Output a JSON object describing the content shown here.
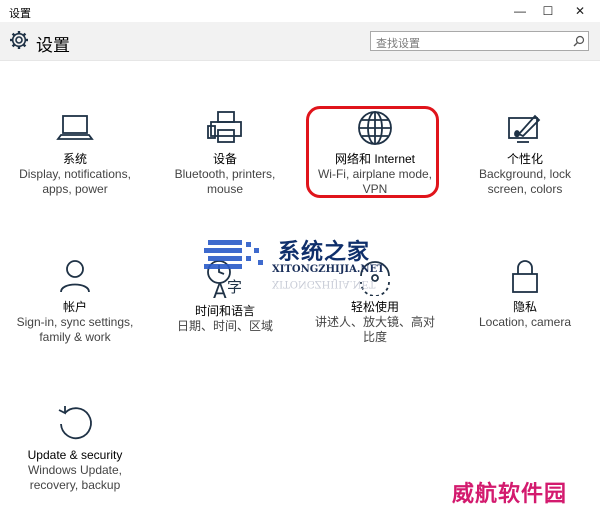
{
  "window": {
    "title": "设置",
    "minimize": "—",
    "maximize": "☐",
    "close": "✕"
  },
  "header": {
    "title": "设置",
    "search_placeholder": "查找设置"
  },
  "tiles": [
    {
      "label": "系统",
      "desc": [
        "Display, notifications,",
        "apps, power"
      ],
      "icon": "laptop-icon"
    },
    {
      "label": "设备",
      "desc": [
        "Bluetooth, printers,",
        "mouse"
      ],
      "icon": "printer-icon"
    },
    {
      "label": "网络和 Internet",
      "desc": [
        "Wi-Fi, airplane mode,",
        "VPN"
      ],
      "icon": "globe-icon"
    },
    {
      "label": "个性化",
      "desc": [
        "Background, lock",
        "screen, colors"
      ],
      "icon": "paintbrush-icon"
    },
    {
      "label": "帐户",
      "desc": [
        "Sign-in, sync settings,",
        "family & work"
      ],
      "icon": "person-icon"
    },
    {
      "label": "时间和语言",
      "desc": [
        "日期、时间、区域"
      ],
      "icon": "time-language-icon"
    },
    {
      "label": "轻松使用",
      "desc": [
        "讲述人、放大镜、高对",
        "比度"
      ],
      "icon": "ease-of-access-icon"
    },
    {
      "label": "隐私",
      "desc": [
        "Location, camera"
      ],
      "icon": "lock-icon"
    },
    {
      "label": "Update & security",
      "desc": [
        "Windows Update,",
        "recovery, backup"
      ],
      "icon": "update-icon"
    }
  ],
  "watermarks": {
    "site_title": "系统之家",
    "site_url": "XITONGZHIJIA.NET",
    "brand": "威航软件园"
  },
  "colors": {
    "accent": "#1f3246",
    "highlight": "#e0141b",
    "brand": "#d31a6e"
  }
}
